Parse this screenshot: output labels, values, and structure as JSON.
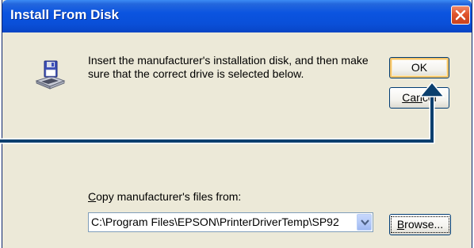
{
  "window": {
    "title": "Install From Disk"
  },
  "message": {
    "text": "Insert the manufacturer's installation disk, and then make sure that the correct drive is selected below."
  },
  "buttons": {
    "ok_label": "OK",
    "cancel_prefix": "Can",
    "cancel_rest": "cel",
    "browse_mnemonic": "B",
    "browse_rest": "rowse..."
  },
  "copy_from": {
    "label_mnemonic": "C",
    "label_rest": "opy manufacturer's files from:",
    "value": "C:\\Program Files\\EPSON\\PrinterDriverTemp\\SP92"
  },
  "icons": {
    "disk": "floppy-disk-drive-icon",
    "close": "close-icon",
    "dropdown": "chevron-down-icon"
  },
  "colors": {
    "titlebar": "#0a54e0",
    "dialog_background": "#ece9d8",
    "close_button": "#e0542c",
    "callout_arrow": "#0a3f6e"
  }
}
